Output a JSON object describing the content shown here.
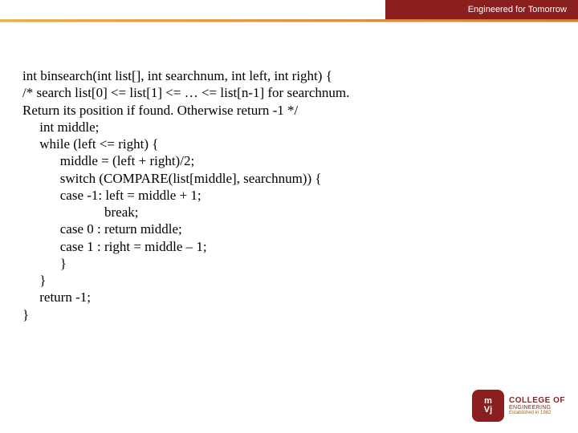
{
  "header": {
    "tagline": "Engineered for Tomorrow"
  },
  "code": {
    "lines": [
      "int binsearch(int list[], int searchnum, int left, int right) {",
      "/* search list[0] <= list[1] <= … <= list[n-1] for searchnum.",
      "Return its position if found. Otherwise return -1 */",
      "     int middle;",
      "     while (left <= right) {",
      "           middle = (left + right)/2;",
      "           switch (COMPARE(list[middle], searchnum)) {",
      "           case -1: left = middle + 1;",
      "                        break;",
      "           case 0 : return middle;",
      "           case 1 : right = middle – 1;",
      "           }",
      "     }",
      "     return -1;",
      "}"
    ]
  },
  "logo": {
    "badge_top": "m",
    "badge_bottom": "Vj",
    "line1": "COLLEGE OF",
    "line2": "ENGINEERING",
    "line3": "Established in 1982"
  }
}
